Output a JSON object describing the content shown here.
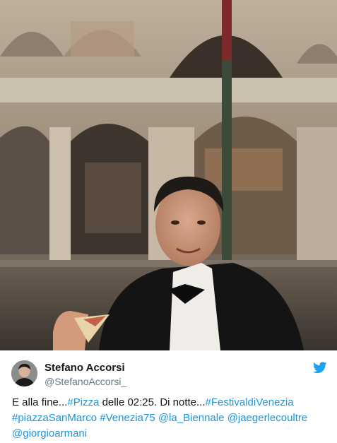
{
  "tweet": {
    "author_name": "Stefano Accorsi",
    "author_handle": "@StefanoAccorsi_",
    "text_parts": [
      "E alla fine...",
      "#Pizza",
      " delle 02:25. Di notte...",
      "#FestivaldiVenezia",
      "#piazzaSanMarco",
      " ",
      "#Venezia75",
      " ",
      "@la_Biennale",
      " ",
      "@jaegerlecoultre",
      "@giorgioarmani"
    ]
  },
  "icons": {
    "brand": "twitter-bird-icon",
    "avatar": "profile-photo"
  },
  "colors": {
    "link": "#1b95e0",
    "handle": "#657786",
    "text": "#14171a",
    "twitter_blue": "#1da1f2"
  }
}
